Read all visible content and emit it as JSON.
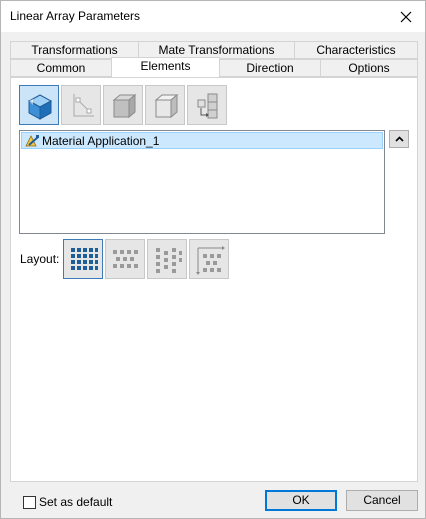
{
  "window": {
    "title": "Linear Array Parameters"
  },
  "tabs": {
    "row1": [
      "Transformations",
      "Mate Transformations",
      "Characteristics"
    ],
    "row2": [
      "Common",
      "Elements",
      "Direction",
      "Options"
    ],
    "active": "Elements"
  },
  "toolbar": {
    "icons": [
      "solid-select-icon",
      "axis-select-icon",
      "box-solid-icon",
      "box-outline-icon",
      "stack-arrow-icon"
    ]
  },
  "elements_list": {
    "items": [
      "Material Application_1"
    ]
  },
  "layout": {
    "label": "Layout:",
    "options": [
      "grid-layout-icon",
      "offset-grid-layout-icon",
      "staggered-layout-icon",
      "path-layout-icon"
    ]
  },
  "footer": {
    "set_default_label": "Set as default",
    "set_default_checked": false,
    "ok_label": "OK",
    "cancel_label": "Cancel"
  },
  "colors": {
    "accent": "#0078d7",
    "selection": "#cce8ff",
    "icon_blue": "#3d8fd6"
  }
}
